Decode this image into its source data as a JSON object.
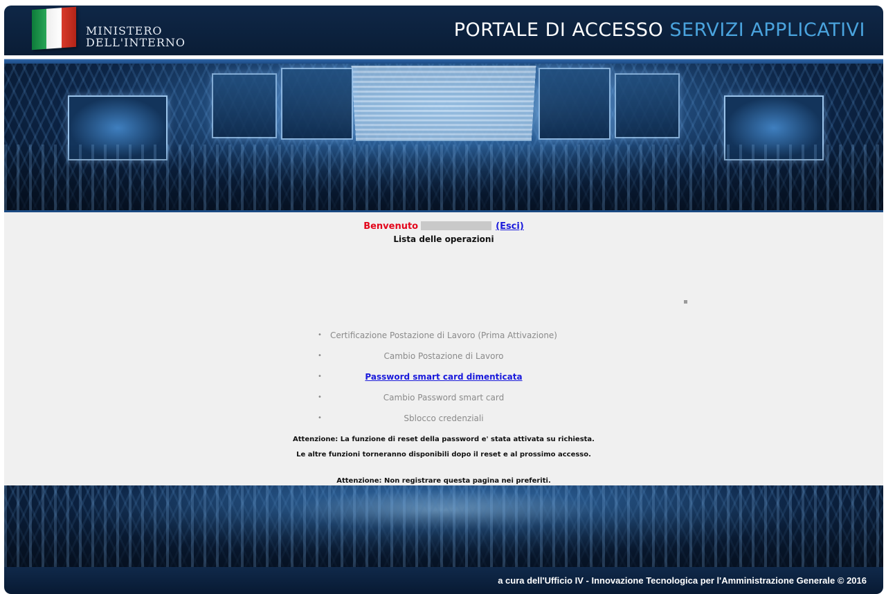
{
  "header": {
    "ministry_line1": "MINISTERO",
    "ministry_line2": "DELL'INTERNO",
    "title_part1": "PORTALE DI ACCESSO",
    "title_part2": "SERVIZI APPLICATIVI",
    "title_part2_color": "#4aa3dd"
  },
  "welcome": {
    "greeting": "Benvenuto",
    "logout_label": "(Esci)",
    "list_title": "Lista delle operazioni"
  },
  "operations": [
    {
      "label": "Certificazione Postazione di Lavoro (Prima Attivazione)",
      "enabled": false
    },
    {
      "label": "Cambio Postazione di Lavoro",
      "enabled": false
    },
    {
      "label": "Password smart card dimenticata",
      "enabled": true
    },
    {
      "label": "Cambio Password smart card",
      "enabled": false
    },
    {
      "label": "Sblocco credenziali",
      "enabled": false
    }
  ],
  "notices": {
    "reset_notice": "Attenzione: La funzione di reset della password e' stata attivata su richiesta.",
    "others_notice": "Le altre funzioni torneranno disponibili dopo il reset e al prossimo accesso.",
    "bookmark_notice": "Attenzione: Non registrare questa pagina nei preferiti."
  },
  "footer": {
    "credit": "a cura dell'Ufficio IV - Innovazione Tecnologica per l'Amministrazione Generale",
    "copyright": "© 2016"
  },
  "colors": {
    "welcome_red": "#e3061b",
    "link_blue": "#1a1adb",
    "header_navy": "#0f2747"
  }
}
